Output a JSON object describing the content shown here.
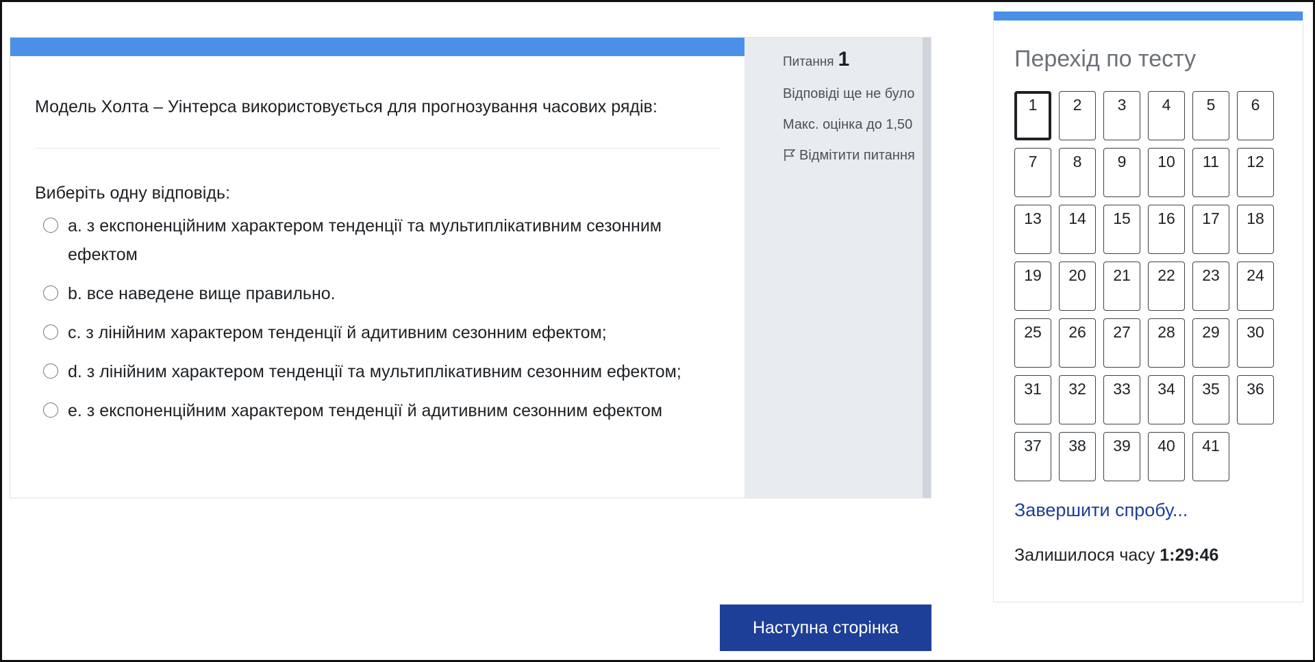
{
  "question": {
    "text": "Модель Холта – Уінтерса використовується для прогнозування часових рядів:",
    "prompt": "Виберіть одну відповідь:",
    "answers": [
      {
        "label": "a. з експоненційним характером тенденції та мультиплікативним сезонним ефектом"
      },
      {
        "label": "b. все наведене вище правильно."
      },
      {
        "label": "c. з лінійним характером тенденції й адитивним сезонним ефектом;"
      },
      {
        "label": "d. з лінійним характером тенденції та мультиплікативним сезонним ефектом;"
      },
      {
        "label": "e. з експоненційним характером тенденції й адитивним сезонним ефектом"
      }
    ]
  },
  "info": {
    "question_label": "Питання",
    "question_number": "1",
    "status": "Відповіді ще не було",
    "max_grade": "Макс. оцінка до 1,50",
    "flag_label": "Відмітити питання",
    "flag_icon": "flag-outline-icon"
  },
  "next_button": "Наступна сторінка",
  "navigation": {
    "title": "Перехід по тесту",
    "current": 1,
    "buttons": [
      "1",
      "2",
      "3",
      "4",
      "5",
      "6",
      "7",
      "8",
      "9",
      "10",
      "11",
      "12",
      "13",
      "14",
      "15",
      "16",
      "17",
      "18",
      "19",
      "20",
      "21",
      "22",
      "23",
      "24",
      "25",
      "26",
      "27",
      "28",
      "29",
      "30",
      "31",
      "32",
      "33",
      "34",
      "35",
      "36",
      "37",
      "38",
      "39",
      "40",
      "41"
    ],
    "finish_link": "Завершити спробу...",
    "time_label": "Залишилося часу",
    "time_value": "1:29:46"
  },
  "colors": {
    "accent_bar": "#4a90e8",
    "primary_button": "#1e3f98",
    "info_bg": "#e9ecef"
  }
}
